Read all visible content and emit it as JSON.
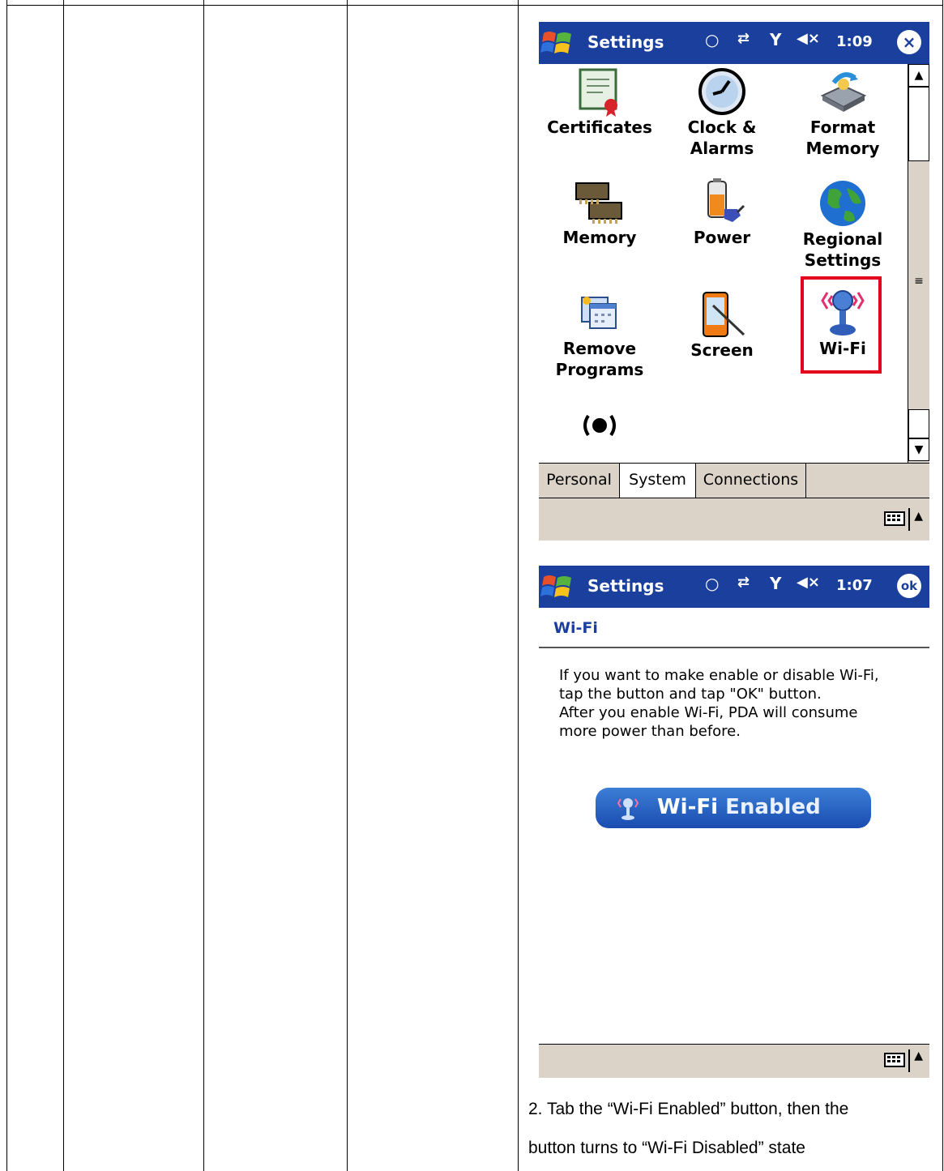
{
  "screen1": {
    "title": "Settings",
    "time": "1:09",
    "items": [
      {
        "label": "Certificates"
      },
      {
        "label": "Clock &",
        "label2": "Alarms"
      },
      {
        "label": "Format",
        "label2": "Memory"
      },
      {
        "label": "Memory"
      },
      {
        "label": "Power"
      },
      {
        "label": "Regional",
        "label2": "Settings"
      },
      {
        "label": "Remove",
        "label2": "Programs"
      },
      {
        "label": "Screen"
      },
      {
        "label": "Wi-Fi"
      }
    ],
    "tabs": [
      "Personal",
      "System",
      "Connections"
    ],
    "active_tab": "System"
  },
  "screen2": {
    "title": "Settings",
    "time": "1:07",
    "ok_label": "ok",
    "subtitle": "Wi-Fi",
    "paragraph": [
      "If you want to make enable or disable Wi-Fi,",
      "tap the button and tap \"OK\" button.",
      "After you enable Wi-Fi, PDA will consume",
      "more power than before."
    ],
    "button": {
      "part1": "Wi-Fi",
      "part2": "Enabled"
    }
  },
  "caption": {
    "line1": "2. Tab the “Wi-Fi Enabled” button, then the",
    "line2": "button turns to “Wi-Fi Disabled” state"
  },
  "colors": {
    "titlebar": "#1b3f9c",
    "highlight": "#e3001b",
    "bar": "#dcd3c8"
  }
}
